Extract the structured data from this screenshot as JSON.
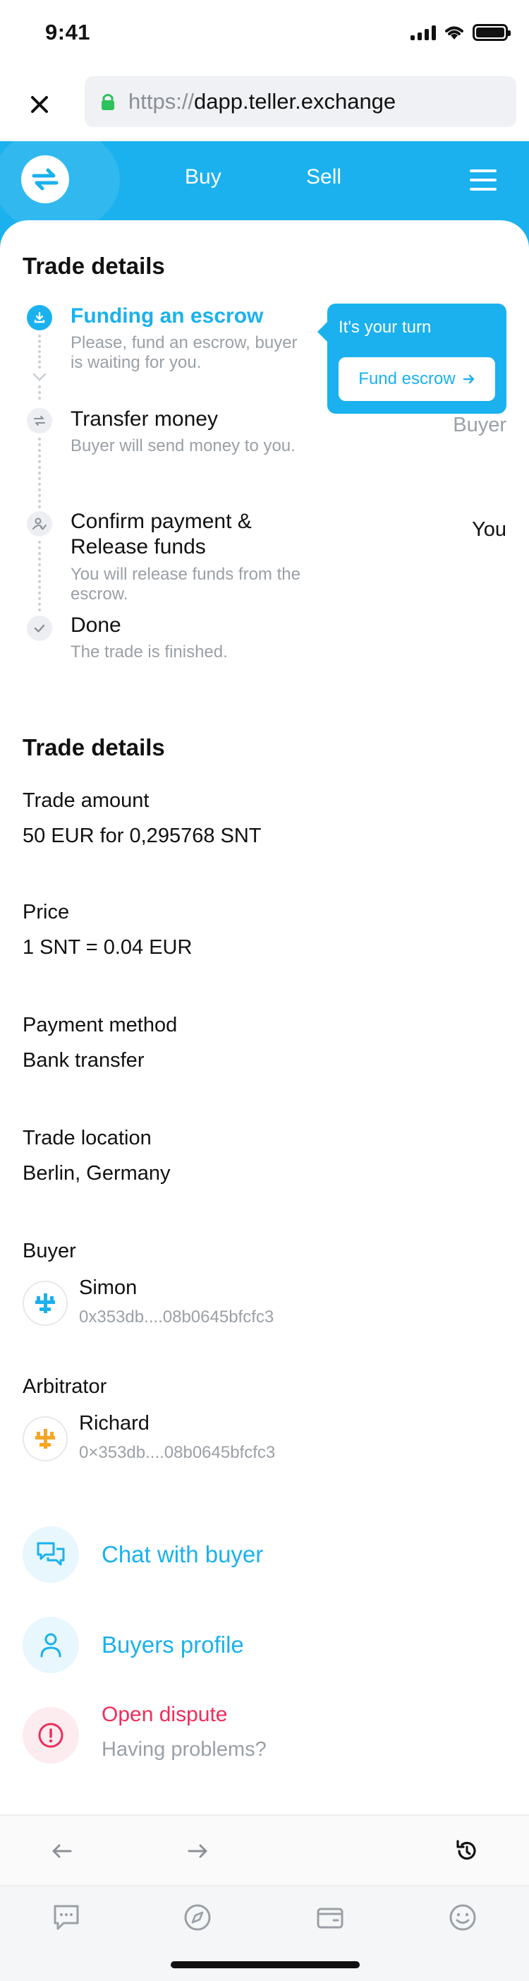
{
  "status_bar": {
    "time": "9:41"
  },
  "browser": {
    "url_protocol": "https://",
    "url_host": "dapp.teller.exchange"
  },
  "header": {
    "nav_buy": "Buy",
    "nav_sell": "Sell"
  },
  "progress": {
    "title": "Trade details",
    "steps": [
      {
        "title": "Funding an escrow",
        "description_line1": "Please, fund an escrow, buyer",
        "description_line2": "is waiting for you.",
        "state": "active"
      },
      {
        "title": "Transfer money",
        "description_line1": "Buyer will send money to you.",
        "role": "Buyer",
        "state": "pending"
      },
      {
        "title_line1": "Confirm payment &",
        "title_line2": "Release funds",
        "description_line1": "You will release funds from the",
        "description_line2": "escrow.",
        "role": "You",
        "state": "pending"
      },
      {
        "title": "Done",
        "description_line1": "The trade is finished.",
        "state": "pending"
      }
    ],
    "tooltip": {
      "text": "It's your turn",
      "button_label": "Fund escrow"
    }
  },
  "details": {
    "title": "Trade details",
    "trade_amount_label": "Trade amount",
    "trade_amount_value": "50 EUR for 0,295768 SNT",
    "price_label": "Price",
    "price_value": "1 SNT = 0.04 EUR",
    "payment_method_label": "Payment method",
    "payment_method_value": "Bank transfer",
    "trade_location_label": "Trade location",
    "trade_location_value": "Berlin, Germany",
    "buyer_label": "Buyer",
    "buyer_name": "Simon",
    "buyer_address": "0x353db....08b0645bfcfc3",
    "arbitrator_label": "Arbitrator",
    "arbitrator_name": "Richard",
    "arbitrator_address": "0×353db....08b0645bfcfc3"
  },
  "actions": {
    "chat": "Chat with buyer",
    "profile": "Buyers profile",
    "dispute_title": "Open dispute",
    "dispute_subtitle": "Having problems?"
  },
  "colors": {
    "accent": "#1ab1ee",
    "danger": "#ee2d5b",
    "muted": "#9aa0a6",
    "buyer_avatar": "#1ab1ee",
    "arbitrator_avatar": "#f6a623"
  },
  "icons": {
    "close": "close-icon",
    "lock": "lock-icon",
    "logo": "swap-arrows-icon",
    "menu": "hamburger-menu-icon",
    "step1": "download-icon",
    "step2": "transfer-arrows-icon",
    "step3": "user-check-icon",
    "step4": "check-icon",
    "chat": "chat-bubbles-icon",
    "profile": "user-icon",
    "dispute": "info-alert-icon",
    "back": "arrow-left-icon",
    "forward": "arrow-right-icon",
    "reload": "reload-icon",
    "tab_chat": "chat-icon",
    "tab_browser": "compass-icon",
    "tab_wallet": "wallet-icon",
    "tab_profile": "smiley-icon"
  }
}
